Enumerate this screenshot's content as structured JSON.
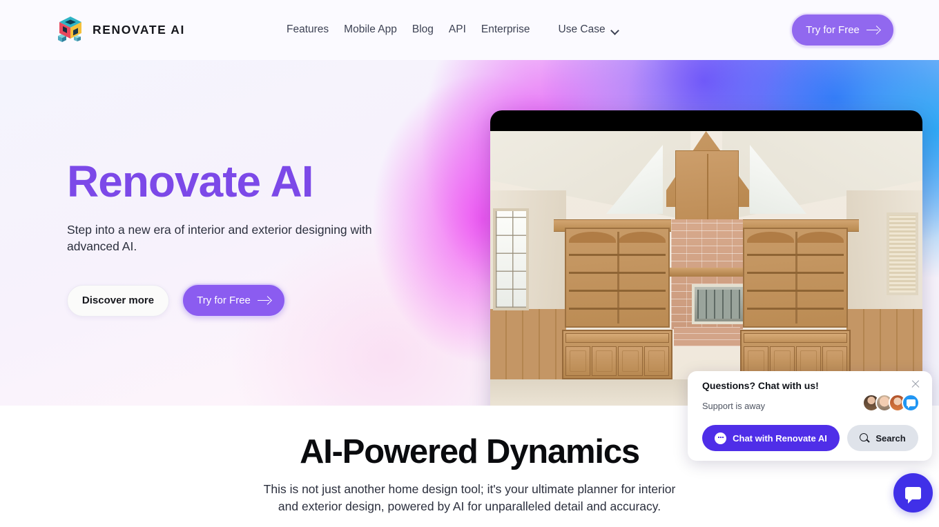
{
  "header": {
    "brand_name": "RENOVATE AI",
    "logo_icon": "cube-logo-icon",
    "nav": [
      {
        "label": "Features",
        "name": "nav-features"
      },
      {
        "label": "Mobile App",
        "name": "nav-mobile-app"
      },
      {
        "label": "Blog",
        "name": "nav-blog"
      },
      {
        "label": "API",
        "name": "nav-api"
      },
      {
        "label": "Enterprise",
        "name": "nav-enterprise"
      }
    ],
    "usecase_label": "Use Case",
    "usecase_icon": "chevron-down-icon",
    "cta_label": "Try for Free",
    "cta_icon": "arrow-right-icon"
  },
  "hero": {
    "title": "Renovate AI",
    "subtitle": "Step into a new era of interior and exterior designing with advanced AI.",
    "btn_secondary": "Discover more",
    "btn_primary": "Try for Free",
    "btn_primary_icon": "arrow-right-icon",
    "image_alt": "wood-paneled-room-with-fireplace"
  },
  "chat_widget": {
    "title": "Questions? Chat with us!",
    "status": "Support is away",
    "close_icon": "close-icon",
    "chat_button_label": "Chat with Renovate AI",
    "chat_button_icon": "chat-bubble-icon",
    "search_button_label": "Search",
    "search_button_icon": "search-icon",
    "avatars": [
      "agent-avatar-1",
      "agent-avatar-2",
      "agent-avatar-3",
      "chat-bubble-avatar"
    ],
    "fab_icon": "chat-bubble-icon"
  },
  "section2": {
    "title": "AI-Powered Dynamics",
    "subtitle": "This is not just another home design tool; it's your ultimate planner for interior and exterior design, powered by AI for unparalleled detail and accuracy."
  },
  "colors": {
    "brand_purple": "#7c49e8",
    "cta_purple": "#8b5cf0",
    "chat_blue_purple": "#4f2ee8",
    "fab_blue": "#4030e8",
    "gradient_magenta": "#ee3ef0",
    "gradient_blue": "#3760fa",
    "gradient_cyan": "#29a8f5"
  }
}
